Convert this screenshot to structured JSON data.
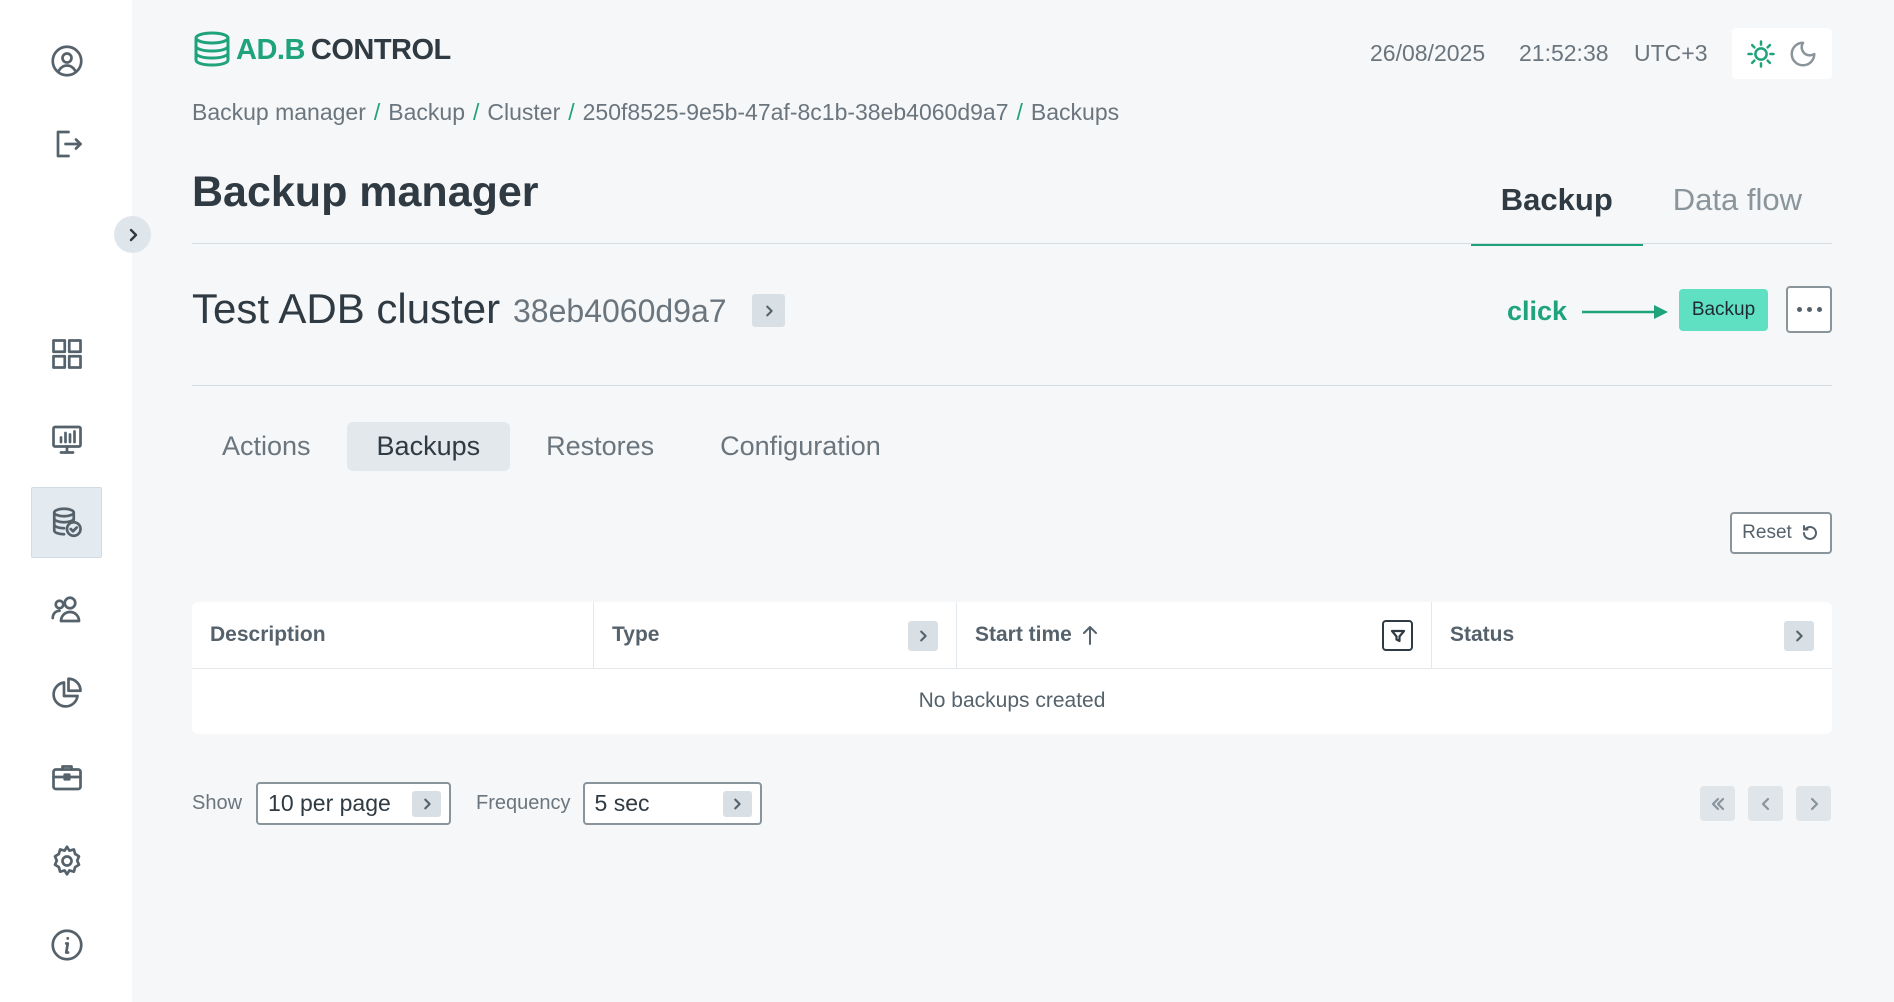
{
  "sidebar": {
    "items": [
      {
        "icon": "user-circle-icon"
      },
      {
        "icon": "logout-icon"
      },
      {
        "icon": "dashboard-grid-icon"
      },
      {
        "icon": "monitoring-icon"
      },
      {
        "icon": "database-check-icon",
        "active": true
      },
      {
        "icon": "users-icon"
      },
      {
        "icon": "pie-chart-icon"
      },
      {
        "icon": "briefcase-icon"
      },
      {
        "icon": "gear-icon"
      },
      {
        "icon": "info-icon"
      }
    ]
  },
  "header": {
    "logo_part1": "AD.B",
    "logo_part2": "CONTROL",
    "date": "26/08/2025",
    "time": "21:52:38",
    "timezone": "UTC+3"
  },
  "breadcrumb": [
    "Backup manager",
    "Backup",
    "Cluster",
    "250f8525-9e5b-47af-8c1b-38eb4060d9a7",
    "Backups"
  ],
  "page": {
    "title": "Backup manager",
    "tabs": [
      {
        "label": "Backup",
        "active": true
      },
      {
        "label": "Data flow",
        "active": false
      }
    ]
  },
  "cluster": {
    "name": "Test ADB cluster",
    "id": "38eb4060d9a7"
  },
  "annotation": {
    "click_label": "click"
  },
  "actions": {
    "backup_label": "Backup"
  },
  "sub_tabs": [
    {
      "label": "Actions",
      "active": false
    },
    {
      "label": "Backups",
      "active": true
    },
    {
      "label": "Restores",
      "active": false
    },
    {
      "label": "Configuration",
      "active": false
    }
  ],
  "reset_label": "Reset",
  "table": {
    "columns": [
      "Description",
      "Type",
      "Start time",
      "Status"
    ],
    "empty_message": "No backups created"
  },
  "pager": {
    "show_label": "Show",
    "per_page": "10 per page",
    "frequency_label": "Frequency",
    "frequency": "5 sec"
  },
  "colors": {
    "accent": "#1fa37a",
    "backup_button": "#5fe0c3"
  }
}
